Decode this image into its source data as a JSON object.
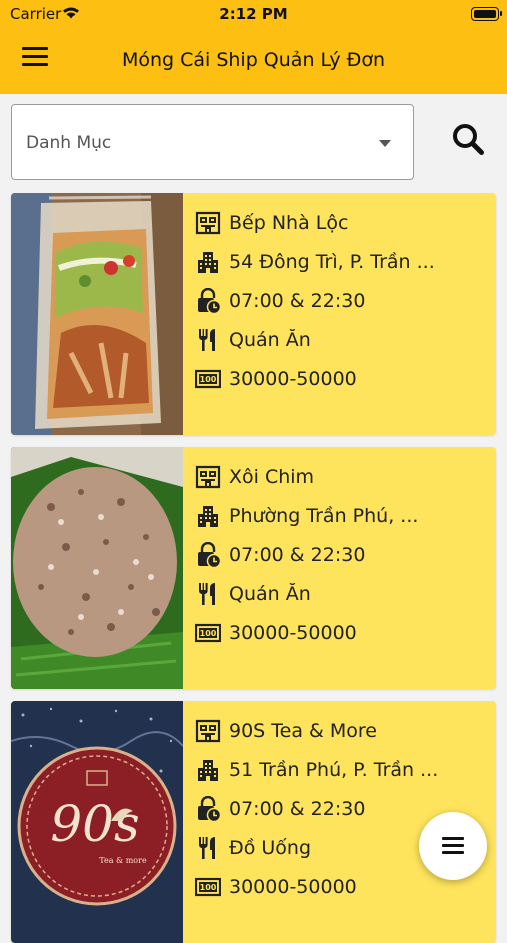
{
  "status_bar": {
    "carrier": "Carrier",
    "time": "2:12 PM"
  },
  "header": {
    "title": "Móng Cái Ship Quản Lý Đơn",
    "menu_icon": "hamburger-icon"
  },
  "filter": {
    "category_label": "Danh Mục",
    "search_icon": "search-icon"
  },
  "stores": [
    {
      "name": "Bếp Nhà Lộc",
      "address": "54 Đông Trì, P. Trần ...",
      "hours": "07:00 & 22:30",
      "type": "Quán Ăn",
      "price": "30000-50000",
      "image": "salad-bag-photo"
    },
    {
      "name": "Xôi Chim",
      "address": "Phường Trần Phú, ...",
      "hours": "07:00 & 22:30",
      "type": "Quán Ăn",
      "price": "30000-50000",
      "image": "sticky-rice-photo"
    },
    {
      "name": "90S Tea & More",
      "address": "51 Trần Phú, P. Trần ...",
      "hours": "07:00 & 22:30",
      "type": "Đồ Uống",
      "price": "30000-50000",
      "image": "90s-logo-photo",
      "logo_text": "90s",
      "logo_sub": "Tea & more"
    }
  ],
  "colors": {
    "header": "#fdbf12",
    "card": "#fee45d",
    "background": "#f2f2f2"
  }
}
